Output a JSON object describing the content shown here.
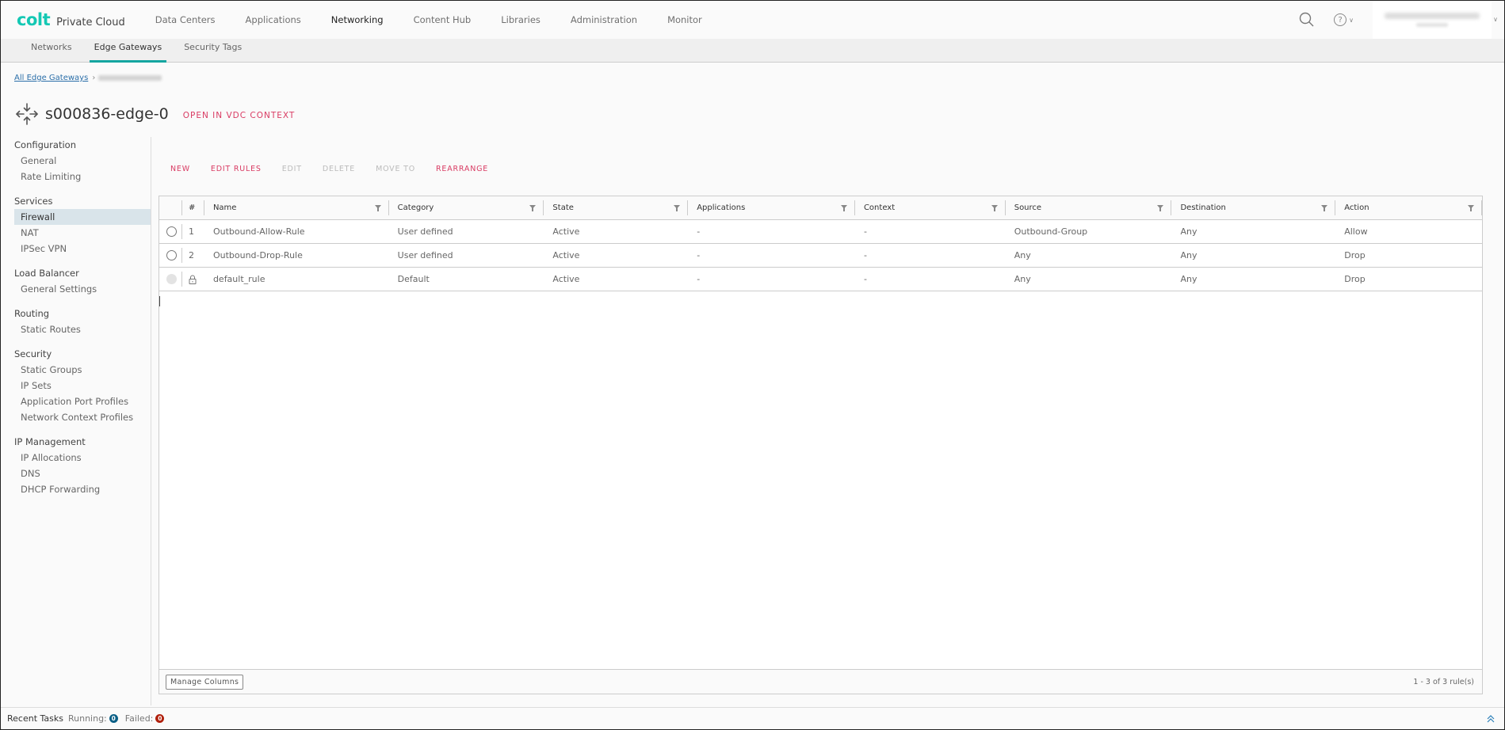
{
  "brand": {
    "logo": "colt",
    "name": "Private Cloud",
    "logo_color": "#14c8b4"
  },
  "topnav": [
    {
      "label": "Data Centers",
      "active": false
    },
    {
      "label": "Applications",
      "active": false
    },
    {
      "label": "Networking",
      "active": true
    },
    {
      "label": "Content Hub",
      "active": false
    },
    {
      "label": "Libraries",
      "active": false
    },
    {
      "label": "Administration",
      "active": false
    },
    {
      "label": "Monitor",
      "active": false
    }
  ],
  "header_right": {
    "search_icon": "search-icon",
    "help_icon": "help-icon",
    "help_glyph": "?",
    "user_name_redacted": true
  },
  "subnav": [
    {
      "label": "Networks",
      "active": false
    },
    {
      "label": "Edge Gateways",
      "active": true
    },
    {
      "label": "Security Tags",
      "active": false
    }
  ],
  "breadcrumb": {
    "parent": "All Edge Gateways",
    "separator": "›",
    "current_redacted": true
  },
  "page": {
    "title": "s000836-edge-0",
    "context_link": "OPEN IN VDC CONTEXT",
    "accent_color": "#d93b63"
  },
  "sidebar": {
    "groups": [
      {
        "label": "Configuration",
        "items": [
          {
            "label": "General"
          },
          {
            "label": "Rate Limiting"
          }
        ]
      },
      {
        "label": "Services",
        "items": [
          {
            "label": "Firewall",
            "active": true
          },
          {
            "label": "NAT"
          },
          {
            "label": "IPSec VPN"
          }
        ]
      },
      {
        "label": "Load Balancer",
        "items": [
          {
            "label": "General Settings"
          }
        ]
      },
      {
        "label": "Routing",
        "items": [
          {
            "label": "Static Routes"
          }
        ]
      },
      {
        "label": "Security",
        "items": [
          {
            "label": "Static Groups"
          },
          {
            "label": "IP Sets"
          },
          {
            "label": "Application Port Profiles"
          },
          {
            "label": "Network Context Profiles"
          }
        ]
      },
      {
        "label": "IP Management",
        "items": [
          {
            "label": "IP Allocations"
          },
          {
            "label": "DNS"
          },
          {
            "label": "DHCP Forwarding"
          }
        ]
      }
    ]
  },
  "toolbar": {
    "new": "NEW",
    "edit_rules": "EDIT RULES",
    "edit": "EDIT",
    "delete": "DELETE",
    "move_to": "MOVE TO",
    "rearrange": "REARRANGE"
  },
  "table": {
    "columns": [
      "#",
      "Name",
      "Category",
      "State",
      "Applications",
      "Context",
      "Source",
      "Destination",
      "Action"
    ],
    "rows": [
      {
        "num": "1",
        "name": "Outbound-Allow-Rule",
        "category": "User defined",
        "state": "Active",
        "applications": "-",
        "context": "-",
        "source": "Outbound-Group",
        "destination": "Any",
        "action": "Allow",
        "locked": false
      },
      {
        "num": "2",
        "name": "Outbound-Drop-Rule",
        "category": "User defined",
        "state": "Active",
        "applications": "-",
        "context": "-",
        "source": "Any",
        "destination": "Any",
        "action": "Drop",
        "locked": false
      },
      {
        "num": "",
        "name": "default_rule",
        "category": "Default",
        "state": "Active",
        "applications": "-",
        "context": "-",
        "source": "Any",
        "destination": "Any",
        "action": "Drop",
        "locked": true
      }
    ],
    "manage_columns": "Manage Columns",
    "pagination": "1 - 3 of 3 rule(s)"
  },
  "statusbar": {
    "title": "Recent Tasks",
    "running_label": "Running:",
    "running_count": "0",
    "running_color": "#0a5f86",
    "failed_label": "Failed:",
    "failed_count": "0",
    "failed_color": "#b0200c"
  }
}
